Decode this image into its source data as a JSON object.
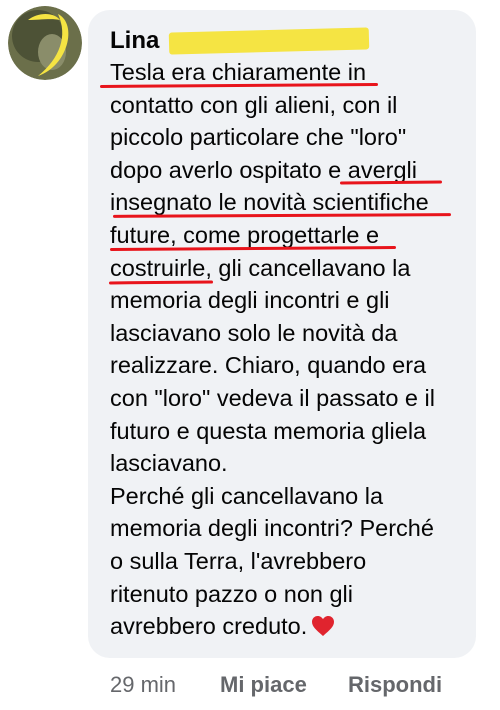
{
  "comment": {
    "author_first": "Lina",
    "author_last_redacted": true,
    "lines": [
      "Tesla era chiaramente in",
      "contatto con gli alieni, con il",
      "piccolo particolare che \"loro\"",
      "dopo averlo ospitato e avergli",
      "insegnato le novità scientifiche",
      "future, come progettarle e",
      "costruirle, gli cancellavano la",
      "memoria degli incontri e gli",
      "lasciavano solo le novità da",
      "realizzare. Chiaro, quando era",
      "con \"loro\" vedeva il passato e il",
      "futuro e questa memoria gliela",
      "lasciavano.",
      "Perché gli cancellavano la",
      "memoria degli incontri? Perché",
      "o sulla Terra, l'avrebbero",
      "ritenuto pazzo o non gli",
      "avrebbero creduto."
    ],
    "emoji_icon": "red-heart-icon"
  },
  "actions": {
    "time": "29 min",
    "like_label": "Mi piace",
    "reply_label": "Rispondi"
  },
  "colors": {
    "bubble": "#f0f2f5",
    "underline": "#e8141b",
    "redaction": "#f5e443",
    "secondary_text": "#65676b"
  }
}
